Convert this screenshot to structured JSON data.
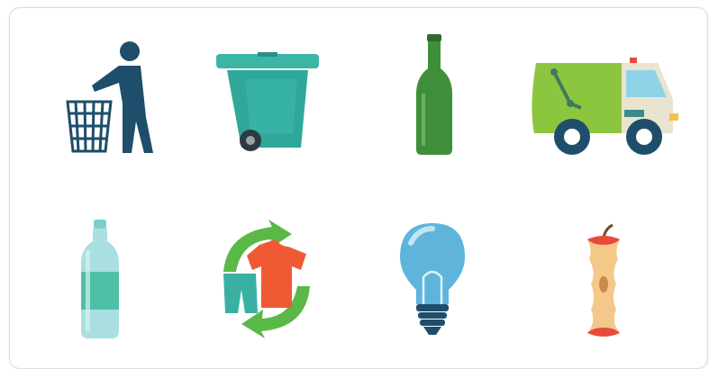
{
  "grid": {
    "icons": [
      {
        "name": "person-trash-icon",
        "color": "#1e4e6b"
      },
      {
        "name": "wheelie-bin-icon",
        "color": "#2fa89b"
      },
      {
        "name": "glass-bottle-icon",
        "color": "#3f8f3a"
      },
      {
        "name": "garbage-truck-icon",
        "color": "#8cc63f"
      },
      {
        "name": "plastic-bottle-icon",
        "color": "#6cc7c1"
      },
      {
        "name": "textile-recycling-icon",
        "color": "#ef5a35"
      },
      {
        "name": "light-bulb-icon",
        "color": "#5fb4dc"
      },
      {
        "name": "apple-core-icon",
        "color": "#f3c88a"
      }
    ]
  }
}
